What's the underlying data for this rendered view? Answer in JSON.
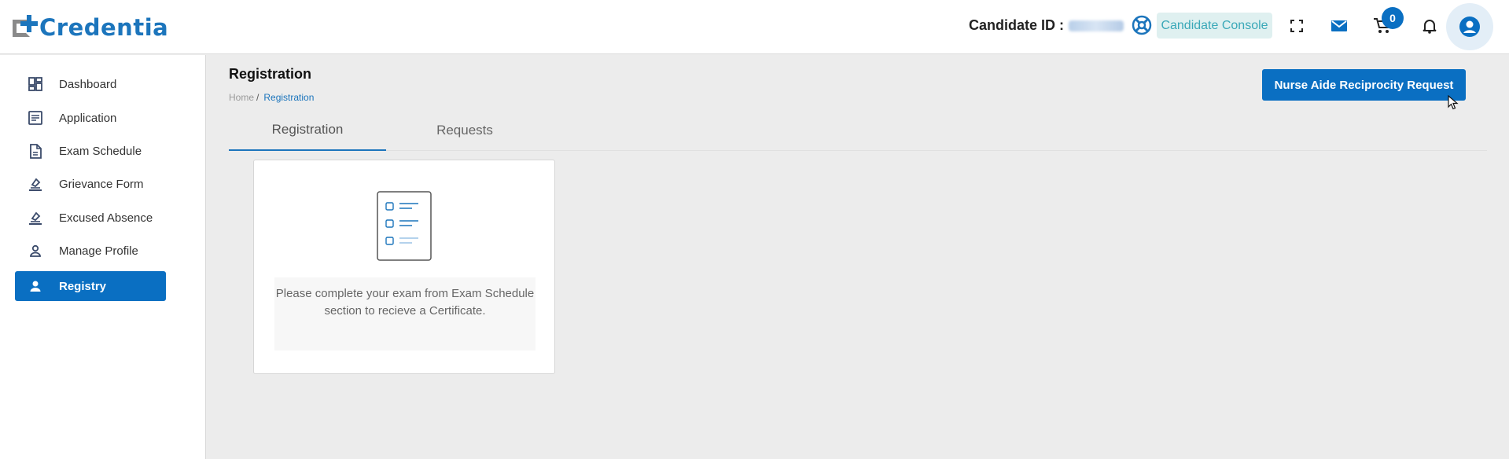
{
  "header": {
    "logo_text": "Credentia",
    "candidate_id_label": "Candidate ID :",
    "console_label": "Candidate Console",
    "cart_count": "0"
  },
  "sidebar": {
    "items": [
      {
        "label": "Dashboard",
        "icon": "dashboard-icon"
      },
      {
        "label": "Application",
        "icon": "application-icon"
      },
      {
        "label": "Exam Schedule",
        "icon": "document-icon"
      },
      {
        "label": "Grievance Form",
        "icon": "stamp-icon"
      },
      {
        "label": "Excused Absence",
        "icon": "stamp-icon"
      },
      {
        "label": "Manage Profile",
        "icon": "person-icon"
      },
      {
        "label": "Registry",
        "icon": "person-icon",
        "active": true
      }
    ]
  },
  "main": {
    "title": "Registration",
    "breadcrumb": {
      "home": "Home",
      "separator": "/",
      "current": "Registration"
    },
    "action_button": "Nurse Aide Reciprocity Request",
    "tabs": [
      {
        "label": "Registration",
        "active": true
      },
      {
        "label": "Requests",
        "active": false
      }
    ],
    "empty_card": {
      "message": "Please complete your exam from Exam Schedule section to recieve a Certificate."
    }
  },
  "colors": {
    "primary": "#0a6fc2",
    "brand": "#1c75bc",
    "console_bg": "#dff0f0",
    "console_text": "#3aa8b8",
    "page_bg": "#ececec"
  }
}
